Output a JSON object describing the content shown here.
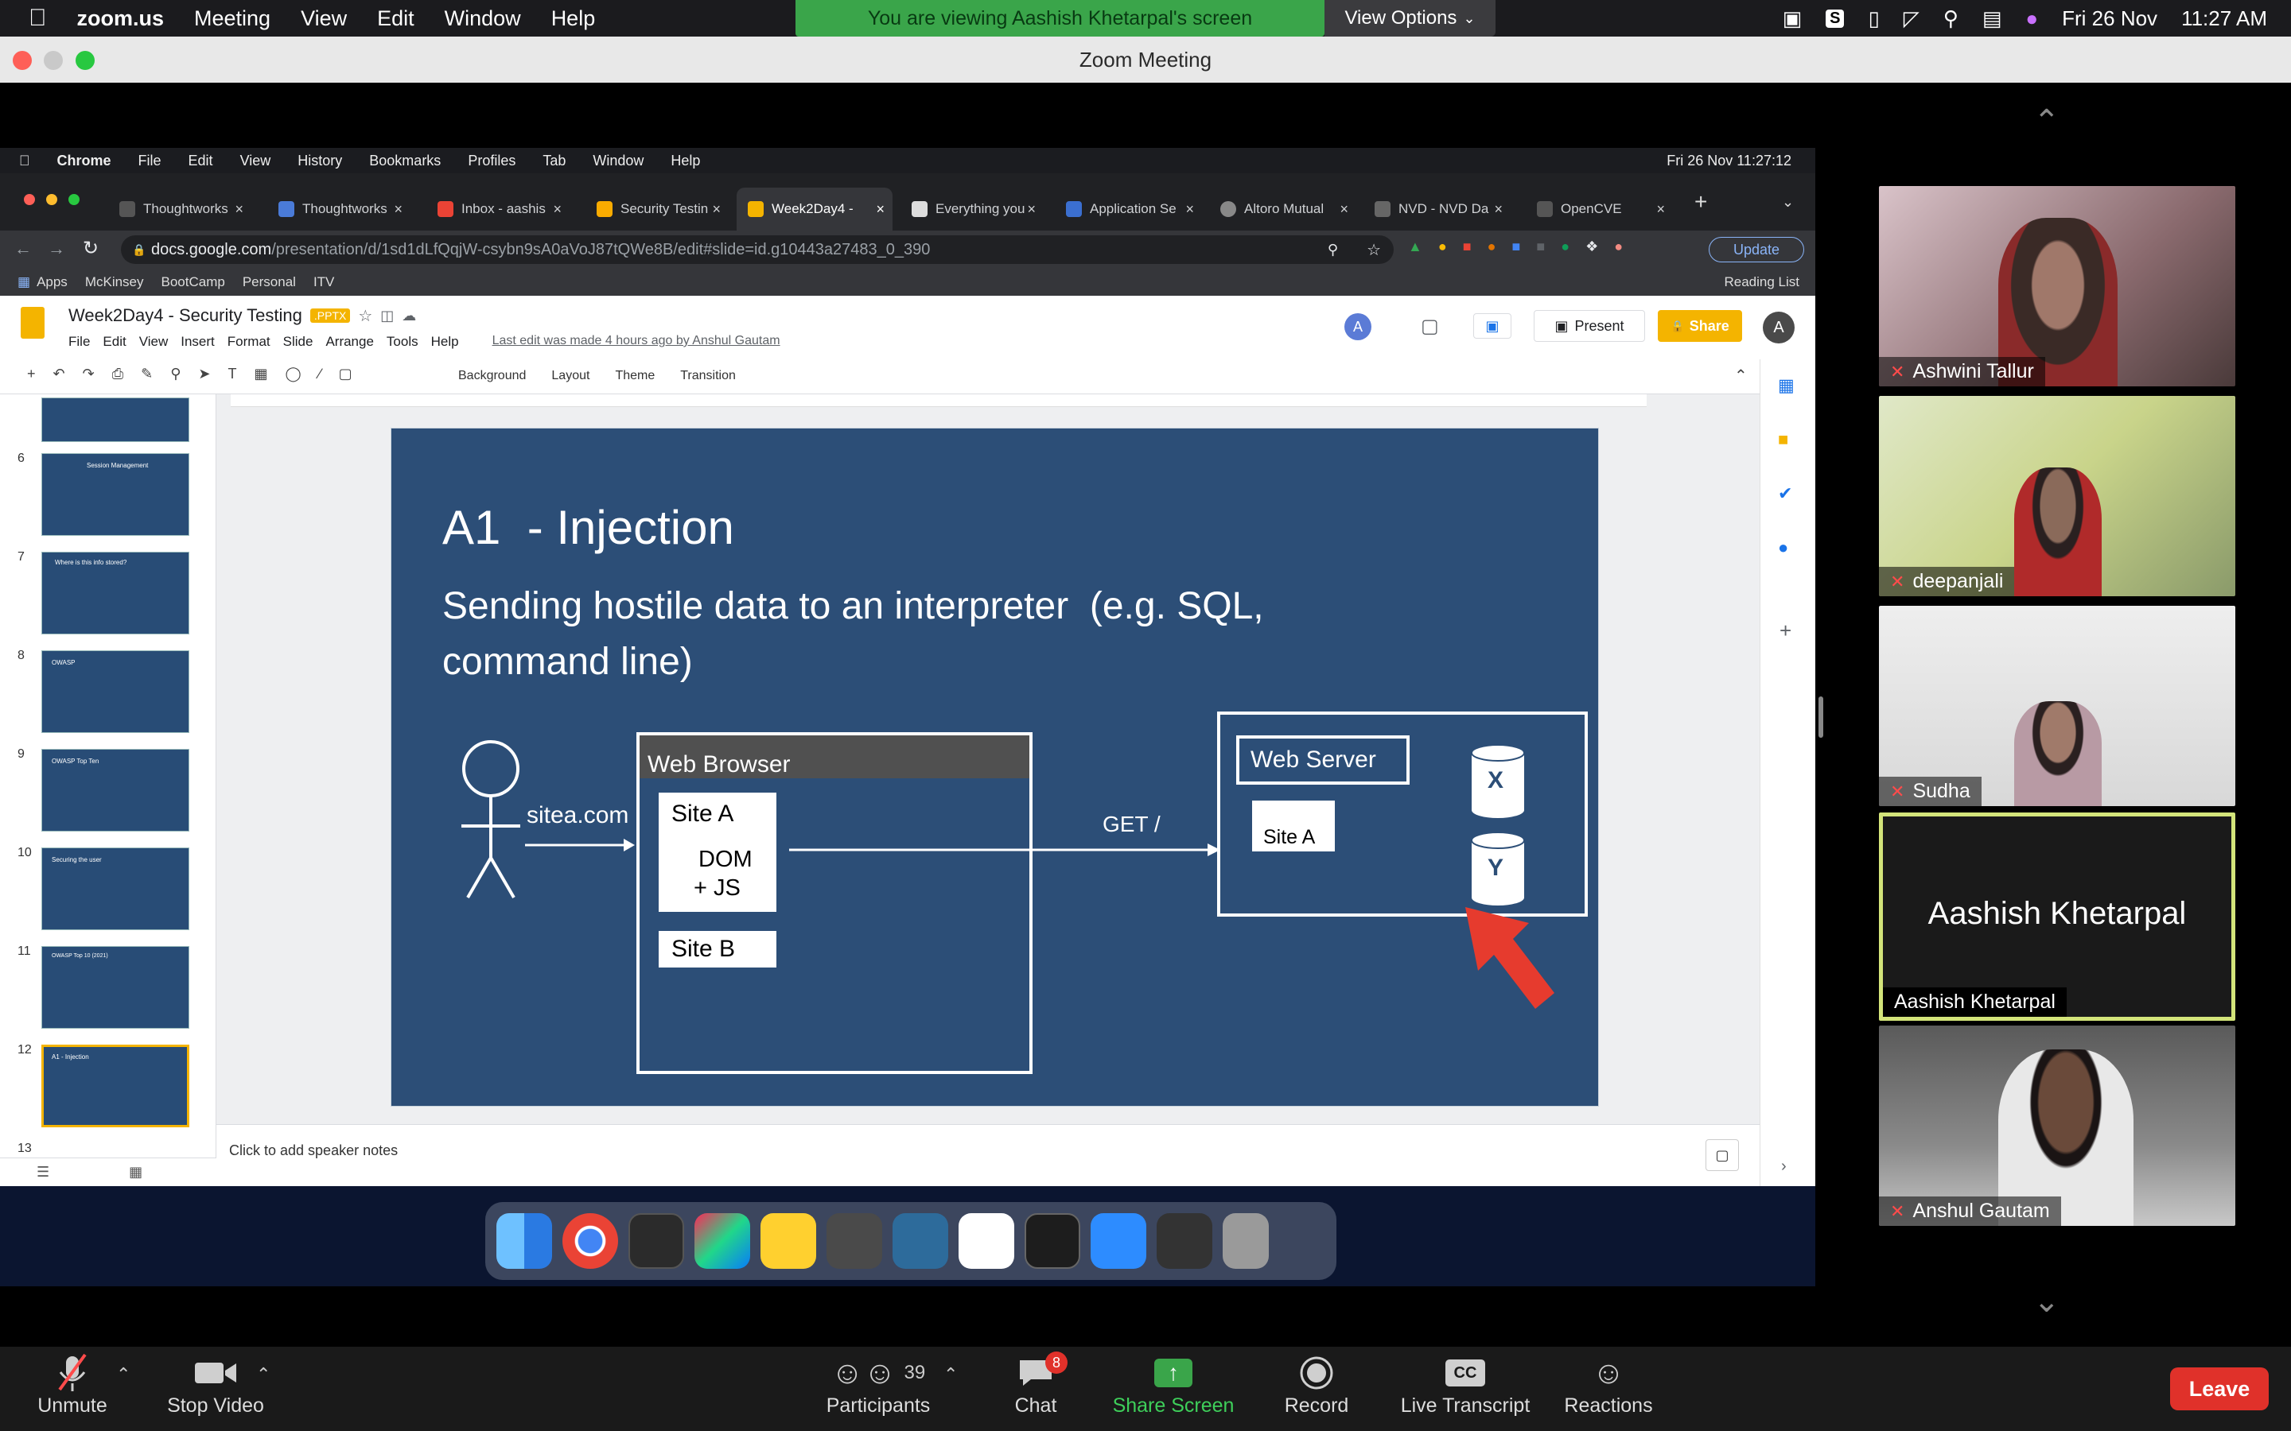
{
  "mac_menu": {
    "app": "zoom.us",
    "items": [
      "Meeting",
      "View",
      "Edit",
      "Window",
      "Help"
    ],
    "date": "Fri 26 Nov",
    "time": "11:27 AM"
  },
  "banner": {
    "text": "You are viewing Aashish Khetarpal's screen",
    "view_options": "View Options"
  },
  "window_title": "Zoom Meeting",
  "chrome_menu": {
    "app": "Chrome",
    "items": [
      "File",
      "Edit",
      "View",
      "History",
      "Bookmarks",
      "Profiles",
      "Tab",
      "Window",
      "Help"
    ],
    "clock": "Fri 26 Nov  11:27:12"
  },
  "tabs": [
    "Thoughtworks",
    "Thoughtworks",
    "Inbox - aashis",
    "Security Testin",
    "Week2Day4 -",
    "Everything you",
    "Application Se",
    "Altoro Mutual",
    "NVD - NVD Da",
    "OpenCVE"
  ],
  "url": {
    "host": "docs.google.com",
    "path": "/presentation/d/1sd1dLfQqjW-csybn9sA0aVoJ87tQWe8B/edit#slide=id.g10443a27483_0_390"
  },
  "chrome_update": "Update",
  "bookmarks": [
    "Apps",
    "McKinsey",
    "BootCamp",
    "Personal",
    "ITV"
  ],
  "reading_list": "Reading List",
  "docs": {
    "title": "Week2Day4 - Security Testing",
    "badge": ".PPTX",
    "menus": [
      "File",
      "Edit",
      "View",
      "Insert",
      "Format",
      "Slide",
      "Arrange",
      "Tools",
      "Help"
    ],
    "last_edit": "Last edit was made 4 hours ago by Anshul Gautam",
    "present": "Present",
    "share": "Share",
    "avatar": "A",
    "toolbar": [
      "Background",
      "Layout",
      "Theme",
      "Transition"
    ],
    "notes": "Click to add speaker notes"
  },
  "thumbnails": [
    "6",
    "7",
    "8",
    "9",
    "10",
    "11",
    "12",
    "13"
  ],
  "thumb_texts": {
    "t6": "Session Management",
    "t7": "Where is this info stored?",
    "t8": "OWASP",
    "t9": "OWASP Top Ten",
    "t10": "Securing the user",
    "t11": "OWASP Top 10 (2021)",
    "t12": "A1 - Injection"
  },
  "slide": {
    "title": "A1  - Injection",
    "subtitle1": "Sending hostile data to an interpreter  (e.g. SQL,",
    "subtitle2": "command line)",
    "browser_label": "Web Browser",
    "site_a": "Site A",
    "dom": "DOM",
    "js": "+ JS",
    "site_b": "Site B",
    "sitea_com": "sitea.com",
    "get": "GET /",
    "web_server": "Web Server",
    "server_site_a": "Site A",
    "db_x": "X",
    "db_y": "Y"
  },
  "participants_tiles": [
    {
      "name": "Ashwini Tallur"
    },
    {
      "name": "deepanjali"
    },
    {
      "name": "Sudha"
    },
    {
      "name": "Aashish Khetarpal",
      "big": "Aashish Khetarpal"
    },
    {
      "name": "Anshul Gautam"
    }
  ],
  "zoom_controls": {
    "unmute": "Unmute",
    "stop_video": "Stop Video",
    "participants": "Participants",
    "participants_count": "39",
    "chat": "Chat",
    "chat_badge": "8",
    "share_screen": "Share Screen",
    "record": "Record",
    "live_transcript": "Live Transcript",
    "reactions": "Reactions",
    "leave": "Leave"
  },
  "colors": {
    "slide_bg": "#2c4e77",
    "share_green": "#3aa54a",
    "leave_red": "#e0312a",
    "active_speaker": "#d3e47a",
    "docs_share": "#f4b400"
  }
}
